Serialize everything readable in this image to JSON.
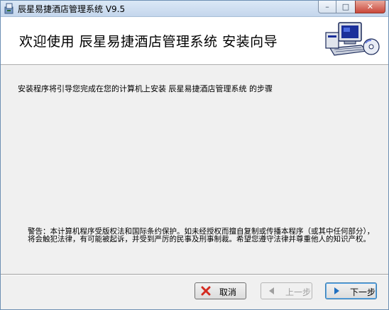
{
  "window": {
    "title": "辰星易捷酒店管理系统 V9.5",
    "controls": {
      "minimize": "–",
      "maximize": "□",
      "close": "✕"
    }
  },
  "header": {
    "title": "欢迎使用  辰星易捷酒店管理系统  安装向导",
    "graphic_icon": "computer-installer-icon"
  },
  "body": {
    "intro": "安装程序将引导您完成在您的计算机上安装  辰星易捷酒店管理系统  的步骤",
    "warning": "警告：本计算机程序受版权法和国际条约保护。如未经授权而擅自复制或传播本程序（或其中任何部分），将会触犯法律，有可能被起诉，并受到严厉的民事及刑事制裁。希望您遵守法律并尊重他人的知识产权。"
  },
  "buttons": {
    "cancel": "取消",
    "back": "上一步",
    "next": "下一步"
  },
  "colors": {
    "cancel_icon": "#d42a20",
    "next_icon": "#1f6fc0",
    "back_icon": "#a0a0a0",
    "close_button": "#c9473a"
  }
}
